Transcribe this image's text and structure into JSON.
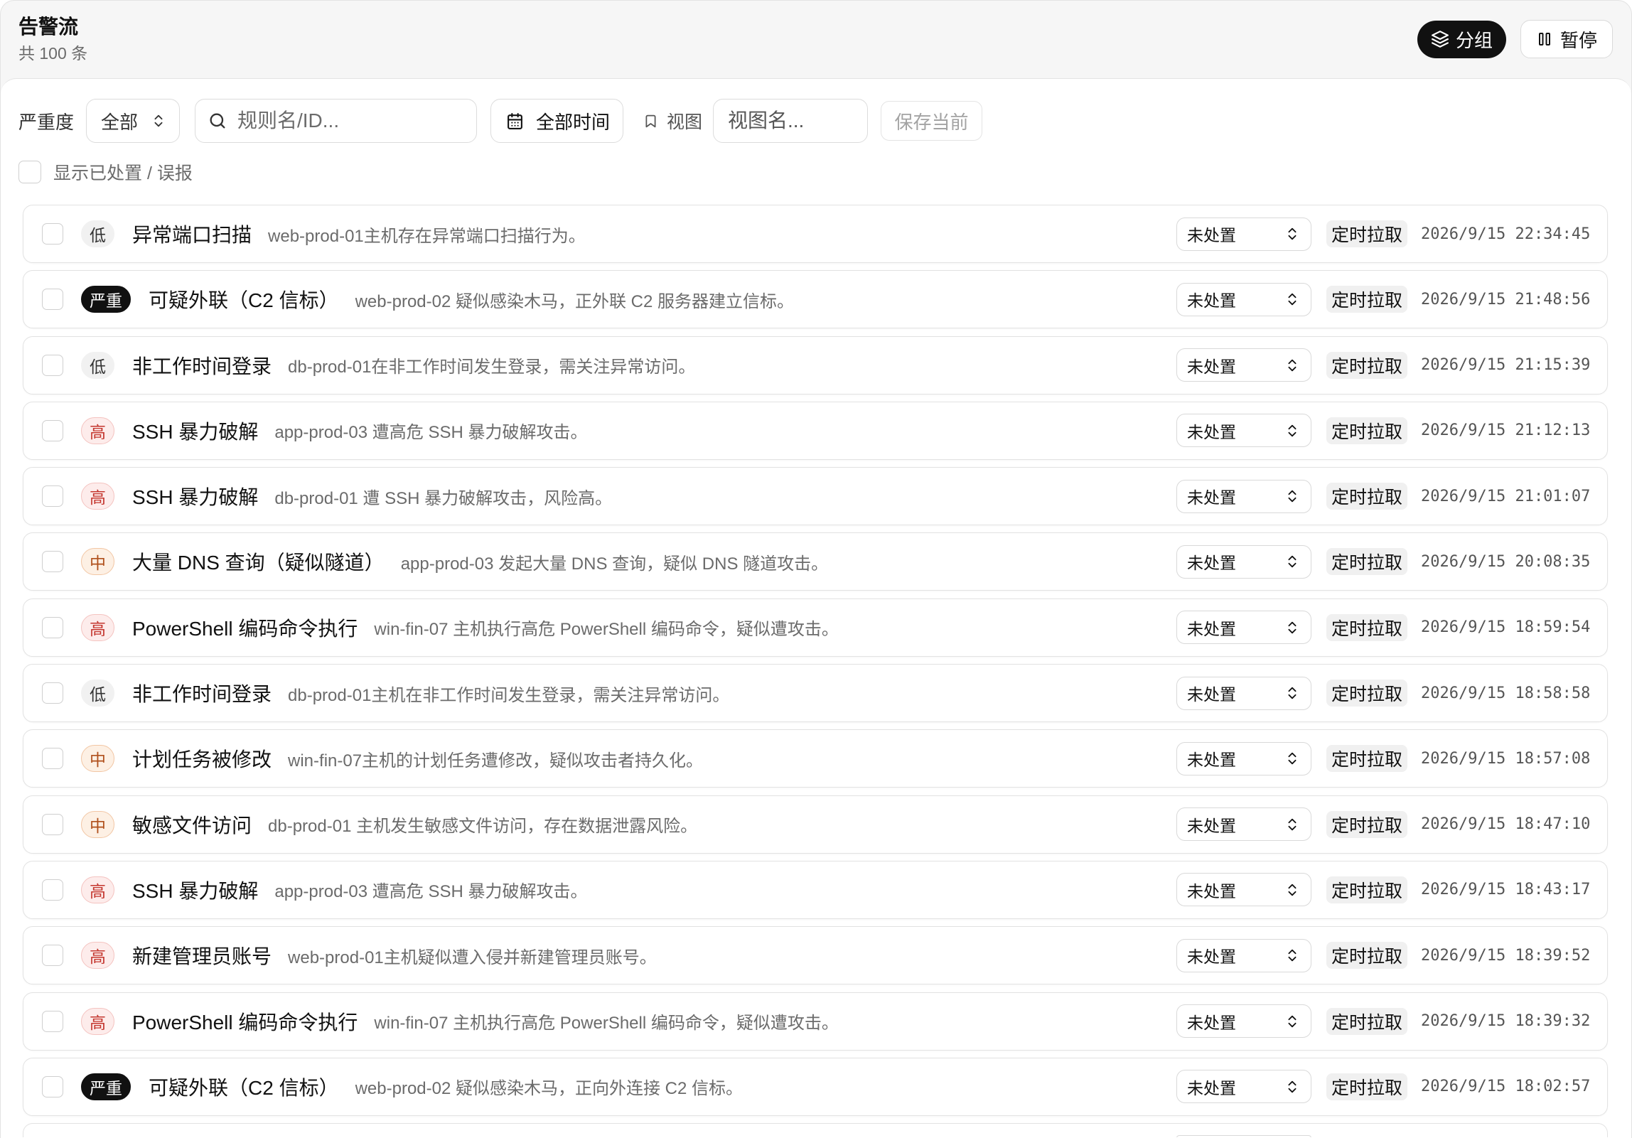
{
  "header": {
    "title": "告警流",
    "count_label": "共 100 条",
    "group_button": "分组",
    "group_icon": "layers-icon",
    "pause_button": "暂停",
    "pause_icon": "pause-icon"
  },
  "filters": {
    "severity_label": "严重度",
    "severity_value": "全部",
    "search_placeholder": "规则名/ID...",
    "search_icon": "search-icon",
    "time_button": "全部时间",
    "time_icon": "calendar-icon",
    "view_label": "视图",
    "view_icon": "bookmark-icon",
    "view_placeholder": "视图名...",
    "save_button": "保存当前",
    "show_handled_label": "显示已处置 / 误报",
    "show_handled_checked": false
  },
  "colors": {
    "primary_button_bg": "#111111",
    "header_bg": "#f6f6f6",
    "source_tag_bg": "#f0f0f0"
  },
  "severity_styles": {
    "低": {
      "bg": "#f1f1f1",
      "fg": "#333333",
      "border": "#f1f1f1"
    },
    "中": {
      "bg": "#fdf0e4",
      "fg": "#b0501c",
      "border": "#f2c6a4"
    },
    "高": {
      "bg": "#fdeceb",
      "fg": "#c4362e",
      "border": "#f4c3c0"
    },
    "严重": {
      "bg": "#111111",
      "fg": "#ffffff",
      "border": "#111111"
    }
  },
  "alerts": [
    {
      "severity": "低",
      "title": "异常端口扫描",
      "description": "web-prod-01主机存在异常端口扫描行为。",
      "status": "未处置",
      "source": "定时拉取",
      "time": "2026/9/15 22:34:45"
    },
    {
      "severity": "严重",
      "title": "可疑外联（C2 信标）",
      "description": "web-prod-02 疑似感染木马，正外联 C2 服务器建立信标。",
      "status": "未处置",
      "source": "定时拉取",
      "time": "2026/9/15 21:48:56"
    },
    {
      "severity": "低",
      "title": "非工作时间登录",
      "description": "db-prod-01在非工作时间发生登录，需关注异常访问。",
      "status": "未处置",
      "source": "定时拉取",
      "time": "2026/9/15 21:15:39"
    },
    {
      "severity": "高",
      "title": "SSH 暴力破解",
      "description": "app-prod-03 遭高危 SSH 暴力破解攻击。",
      "status": "未处置",
      "source": "定时拉取",
      "time": "2026/9/15 21:12:13"
    },
    {
      "severity": "高",
      "title": "SSH 暴力破解",
      "description": "db-prod-01 遭 SSH 暴力破解攻击，风险高。",
      "status": "未处置",
      "source": "定时拉取",
      "time": "2026/9/15 21:01:07"
    },
    {
      "severity": "中",
      "title": "大量 DNS 查询（疑似隧道）",
      "description": "app-prod-03 发起大量 DNS 查询，疑似 DNS 隧道攻击。",
      "status": "未处置",
      "source": "定时拉取",
      "time": "2026/9/15 20:08:35"
    },
    {
      "severity": "高",
      "title": "PowerShell 编码命令执行",
      "description": "win-fin-07 主机执行高危 PowerShell 编码命令，疑似遭攻击。",
      "status": "未处置",
      "source": "定时拉取",
      "time": "2026/9/15 18:59:54"
    },
    {
      "severity": "低",
      "title": "非工作时间登录",
      "description": "db-prod-01主机在非工作时间发生登录，需关注异常访问。",
      "status": "未处置",
      "source": "定时拉取",
      "time": "2026/9/15 18:58:58"
    },
    {
      "severity": "中",
      "title": "计划任务被修改",
      "description": "win-fin-07主机的计划任务遭修改，疑似攻击者持久化。",
      "status": "未处置",
      "source": "定时拉取",
      "time": "2026/9/15 18:57:08"
    },
    {
      "severity": "中",
      "title": "敏感文件访问",
      "description": "db-prod-01 主机发生敏感文件访问，存在数据泄露风险。",
      "status": "未处置",
      "source": "定时拉取",
      "time": "2026/9/15 18:47:10"
    },
    {
      "severity": "高",
      "title": "SSH 暴力破解",
      "description": "app-prod-03 遭高危 SSH 暴力破解攻击。",
      "status": "未处置",
      "source": "定时拉取",
      "time": "2026/9/15 18:43:17"
    },
    {
      "severity": "高",
      "title": "新建管理员账号",
      "description": "web-prod-01主机疑似遭入侵并新建管理员账号。",
      "status": "未处置",
      "source": "定时拉取",
      "time": "2026/9/15 18:39:52"
    },
    {
      "severity": "高",
      "title": "PowerShell 编码命令执行",
      "description": "win-fin-07 主机执行高危 PowerShell 编码命令，疑似遭攻击。",
      "status": "未处置",
      "source": "定时拉取",
      "time": "2026/9/15 18:39:32"
    },
    {
      "severity": "严重",
      "title": "可疑外联（C2 信标）",
      "description": "web-prod-02 疑似感染木马，正向外连接 C2 信标。",
      "status": "未处置",
      "source": "定时拉取",
      "time": "2026/9/15 18:02:57"
    }
  ]
}
